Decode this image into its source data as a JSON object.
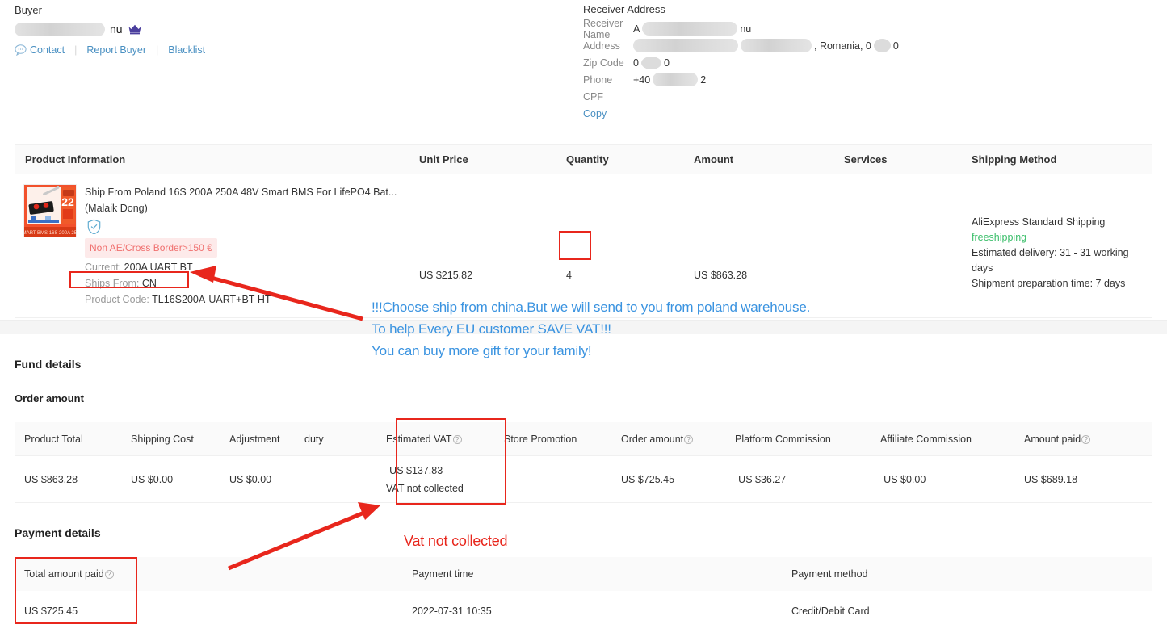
{
  "buyer": {
    "label": "Buyer",
    "name_suffix": "nu",
    "name_redacted": true,
    "crown_icon": "crown-icon",
    "links": [
      {
        "label": "Contact",
        "icon": "chat-bubble-icon"
      },
      {
        "label": "Report Buyer"
      },
      {
        "label": "Blacklist"
      }
    ]
  },
  "receiver": {
    "title": "Receiver Address",
    "rows": [
      {
        "key": "Receiver Name",
        "value_prefix": "A",
        "value_suffix": "nu",
        "redacted": true
      },
      {
        "key": "Address",
        "value_prefix": "",
        "value_suffix": ", Romania, 0",
        "value_tail": "0",
        "redacted": true
      },
      {
        "key": "Zip Code",
        "value_prefix": "0",
        "value_suffix": "0",
        "redacted": true
      },
      {
        "key": "Phone",
        "value_prefix": "+40",
        "value_suffix": "2",
        "redacted": true
      },
      {
        "key": "CPF",
        "value_prefix": "",
        "value_suffix": "",
        "redacted": false
      }
    ],
    "copy_label": "Copy"
  },
  "product_table": {
    "headers": [
      "Product Information",
      "Unit Price",
      "Quantity",
      "Amount",
      "Services",
      "Shipping Method"
    ],
    "row": {
      "title": "Ship From Poland 16S 200A 250A 48V Smart BMS For LifePO4 Bat...",
      "store": "(Malaik Dong)",
      "verified_icon": "shield-check-icon",
      "badge": "Non AE/Cross Border>150 €",
      "attrs": [
        {
          "key": "Current:",
          "value": "200A UART BT"
        },
        {
          "key": "Ships From:",
          "value": "CN"
        },
        {
          "key": "Product Code:",
          "value": "TL16S200A-UART+BT-HT"
        }
      ],
      "unit_price": "US $215.82",
      "quantity": "4",
      "amount": "US $863.28",
      "services": "",
      "shipping": {
        "method": "AliExpress Standard Shipping",
        "free_label": "freeshipping",
        "delivery": "Estimated delivery: 31 - 31 working days",
        "preparation": "Shipment preparation time: 7 days"
      }
    }
  },
  "fund_details": {
    "title": "Fund details",
    "subtitle": "Order amount",
    "headers": [
      "Product Total",
      "Shipping Cost",
      "Adjustment",
      "duty",
      "Estimated VAT",
      "Store Promotion",
      "Order amount",
      "Platform Commission",
      "Affiliate Commission",
      "Amount paid"
    ],
    "values": {
      "product_total": "US $863.28",
      "shipping_cost": "US $0.00",
      "adjustment": "US $0.00",
      "duty": "-",
      "estimated_vat_amount": "-US $137.83",
      "estimated_vat_note": "VAT not collected",
      "store_promotion": "-",
      "order_amount": "US $725.45",
      "platform_commission": "-US $36.27",
      "affiliate_commission": "-US $0.00",
      "amount_paid": "US $689.18"
    }
  },
  "payment_details": {
    "title": "Payment details",
    "headers": [
      "Total amount paid",
      "Payment time",
      "Payment method"
    ],
    "values": {
      "total_amount_paid": "US $725.45",
      "payment_time": "2022-07-31 10:35",
      "payment_method": "Credit/Debit Card"
    }
  },
  "annotations": {
    "blue_lines": [
      "!!!Choose ship from china.But we will send to you from poland warehouse.",
      "To help Every EU customer SAVE VAT!!!",
      "You can buy more gift for your family!"
    ],
    "red_text": "Vat not collected",
    "color_red": "#e8261c",
    "color_blue": "#3a93e0",
    "boxes": [
      "ships-from",
      "quantity",
      "estimated-vat",
      "total-amount-paid"
    ],
    "arrows": [
      "arrow-to-ships-from",
      "arrow-to-estimated-vat"
    ]
  },
  "colors": {
    "accent_link": "#4a90c2",
    "free_shipping_green": "#3cbf6b",
    "badge_pink_bg": "#fdeaea",
    "badge_pink_fg": "#f0706f",
    "crown_purple": "#4b3f9e"
  }
}
